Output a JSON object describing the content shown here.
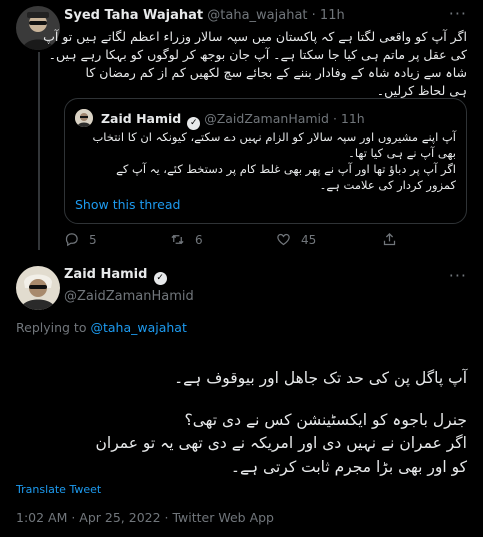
{
  "reply_tweet": {
    "name": "Syed Taha Wajahat",
    "handle": "@taha_wajahat",
    "age": "11h",
    "more": "···",
    "text_lines": [
      "اگر آپ کو واقعی لگتا ہے کہ پاکستان میں سپہ سالار وزراء اعظم لگاتے ہیں تو آپ",
      "کی عقل پر ماتم ہی کیا جا سکتا ہے۔ آپ جان بوجھ کر لوگوں کو بہکا رہے ہیں۔",
      "شاہ سے زیادہ شاہ کے وفادار بننے کے بجائے سچ لکھیں کم از کم رمضان کا",
      "ہی لحاظ کرلیں۔"
    ],
    "quote": {
      "name": "Zaid Hamid",
      "handle": "@ZaidZamanHamid",
      "age": "11h",
      "text_lines": [
        "آپ اپنے مشیروں اور سپہ سالار کو الزام نہیں دے سکتے، کیونکہ ان کا انتخاب",
        "بھی آپ نے ہی کیا تھا۔",
        "اگر آپ پر دباؤ تھا اور آپ نے پھر بھی غلط کام پر دستخط کئے، یہ آپ کے",
        "کمزور کردار کی علامت ہے۔"
      ],
      "show_thread": "Show this thread"
    },
    "actions": {
      "replies": "5",
      "retweets": "6",
      "likes": "45"
    }
  },
  "main_tweet": {
    "name": "Zaid Hamid",
    "handle": "@ZaidZamanHamid",
    "replying_prefix": "Replying to",
    "replying_handle": "@taha_wajahat",
    "text_lines": [
      "آپ پاگل پن کی حد تک جاھل اور بیوقوف ہے۔",
      "جنرل باجوہ کو ایکسٹینشن کس نے دی تھی؟",
      "اگر عمران نے نہیں دی اور امریکہ نے دی تھی یہ تو عمران",
      "کو اور بھی بڑا مجرم ثابت کرتی ہے۔"
    ],
    "translate": "Translate Tweet",
    "timestamp": "1:02 AM · Apr 25, 2022 · Twitter Web App"
  },
  "colors": {
    "background": "#000000",
    "text": "#e7e9ea",
    "muted": "#71767b",
    "link": "#1d9bf0",
    "border": "#2f3336"
  }
}
